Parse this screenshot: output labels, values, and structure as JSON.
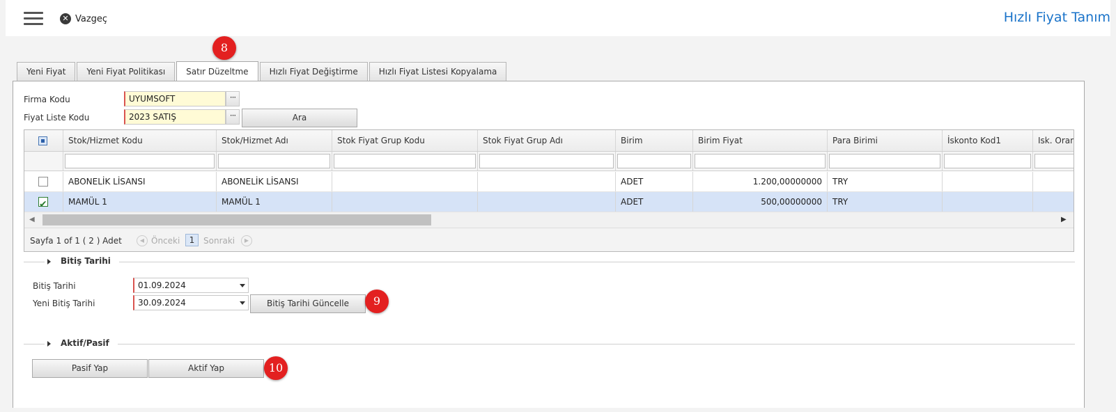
{
  "header": {
    "cancel_label": "Vazgeç",
    "page_title": "Hızlı Fiyat Tanım"
  },
  "badges": {
    "b8": "8",
    "b9": "9",
    "b10": "10"
  },
  "tabs": [
    {
      "label": "Yeni Fiyat",
      "active": false
    },
    {
      "label": "Yeni Fiyat Politikası",
      "active": false
    },
    {
      "label": "Satır Düzeltme",
      "active": true
    },
    {
      "label": "Hızlı Fiyat Değiştirme",
      "active": false
    },
    {
      "label": "Hızlı Fiyat Listesi Kopyalama",
      "active": false
    }
  ],
  "form": {
    "firma_kodu_label": "Firma Kodu",
    "firma_kodu_value": "UYUMSOFT",
    "fiyat_liste_label": "Fiyat Liste Kodu",
    "fiyat_liste_value": "2023 SATIŞ",
    "lookup_dots": "···",
    "search_label": "Ara"
  },
  "grid": {
    "columns": [
      "Stok/Hizmet Kodu",
      "Stok/Hizmet Adı",
      "Stok Fiyat Grup Kodu",
      "Stok Fiyat Grup Adı",
      "Birim",
      "Birim Fiyat",
      "Para Birimi",
      "İskonto Kod1",
      "Isk. Oranı"
    ],
    "rows": [
      {
        "checked": false,
        "selected": false,
        "cells": [
          "ABONELİK LİSANSI",
          "ABONELİK LİSANSI",
          "",
          "",
          "ADET",
          "1.200,00000000",
          "TRY",
          "",
          ""
        ]
      },
      {
        "checked": true,
        "selected": true,
        "cells": [
          "MAMÜL 1",
          "MAMÜL 1",
          "",
          "",
          "ADET",
          "500,00000000",
          "TRY",
          "",
          ""
        ]
      }
    ]
  },
  "pager": {
    "summary": "Sayfa 1 of 1 ( 2 ) Adet",
    "prev": "Önceki",
    "current": "1",
    "next": "Sonraki"
  },
  "end_date_section": {
    "title": "Bitiş Tarihi",
    "end_date_label": "Bitiş Tarihi",
    "end_date_value": "01.09.2024",
    "new_end_date_label": "Yeni Bitiş Tarihi",
    "new_end_date_value": "30.09.2024",
    "update_button": "Bitiş Tarihi Güncelle"
  },
  "status_section": {
    "title": "Aktif/Pasif",
    "passive_button": "Pasif Yap",
    "active_button": "Aktif Yap"
  }
}
